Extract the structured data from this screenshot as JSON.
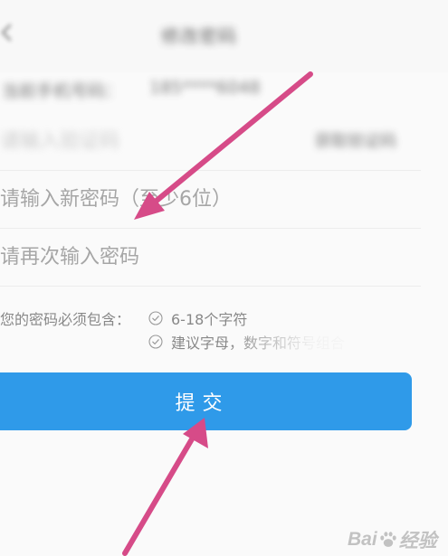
{
  "header": {
    "back_icon": "chevron-left-icon",
    "title": "修改密码"
  },
  "account": {
    "phone_label": "当前手机号码：",
    "phone_value": "185****6048"
  },
  "form": {
    "code_placeholder": "请输入验证码",
    "send_code_label": "获取验证码",
    "new_password_placeholder": "请输入新密码（至少6位）",
    "confirm_password_placeholder": "请再次输入密码"
  },
  "hints": {
    "label": "您的密码必须包含：",
    "rules": [
      "6-18个字符",
      "建议字母，数字和符号组合"
    ],
    "check_icon": "check-circle-icon"
  },
  "submit_label": "提交",
  "annotation": {
    "arrow_color": "#d64b88",
    "arrows": [
      "arrow-to-new-password-field",
      "arrow-to-submit-button"
    ]
  },
  "watermark": {
    "text_left": "Bai",
    "text_right": "经验",
    "icon": "paw-icon"
  },
  "colors": {
    "primary_button": "#2f9ae9",
    "placeholder": "#a6a6a6",
    "hint_text": "#888888"
  }
}
